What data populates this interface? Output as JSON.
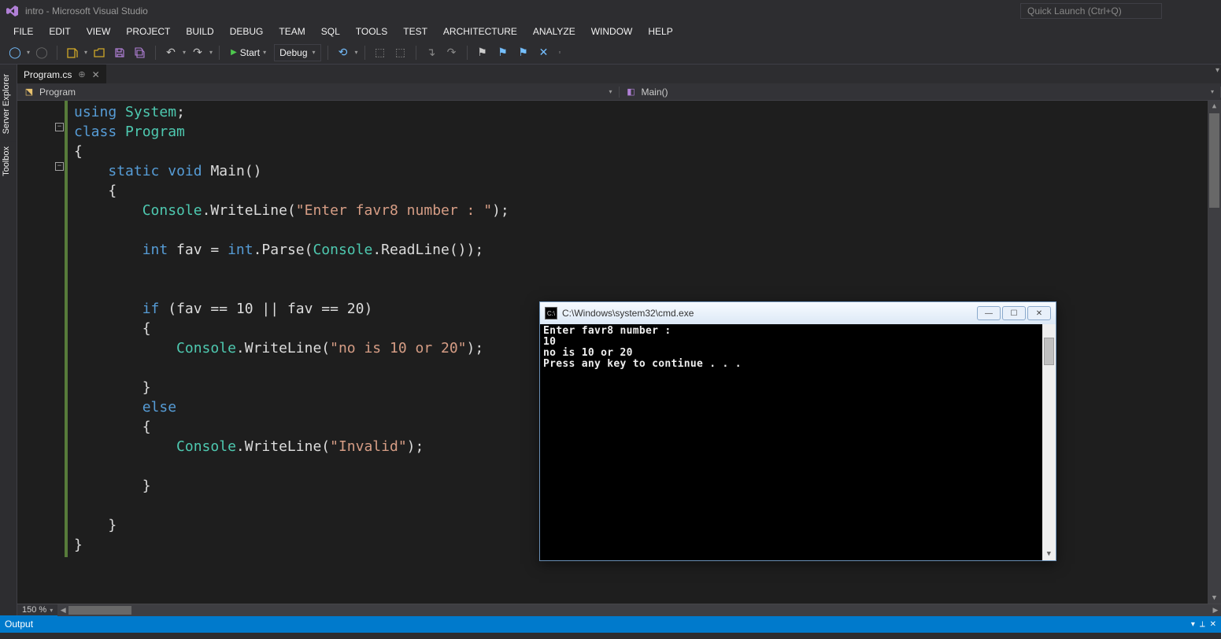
{
  "title_bar": {
    "app_title": "intro - Microsoft Visual Studio",
    "quick_launch_placeholder": "Quick Launch (Ctrl+Q)"
  },
  "menu": [
    "FILE",
    "EDIT",
    "VIEW",
    "PROJECT",
    "BUILD",
    "DEBUG",
    "TEAM",
    "SQL",
    "TOOLS",
    "TEST",
    "ARCHITECTURE",
    "ANALYZE",
    "WINDOW",
    "HELP"
  ],
  "toolbar": {
    "start_label": "Start",
    "config_label": "Debug"
  },
  "side_tabs": [
    "Server Explorer",
    "Toolbox"
  ],
  "editor": {
    "tab_name": "Program.cs",
    "breadcrumb_left": "Program",
    "breadcrumb_right": "Main()",
    "zoom": "150 %"
  },
  "code": {
    "l1_using": "using",
    "l1_system": "System",
    "l1_semi": ";",
    "l2_class": "class",
    "l2_program": "Program",
    "l3_open": "{",
    "l4_static": "static",
    "l4_void": "void",
    "l4_main": "Main",
    "l4_parens": "()",
    "l5_open": "{",
    "l6_console": "Console",
    "l6_dot": ".",
    "l6_writeline": "WriteLine",
    "l6_open_p": "(",
    "l6_str": "\"Enter favr8 number : \"",
    "l6_close": ");",
    "l8_int": "int",
    "l8_fav": " fav = ",
    "l8_int2": "int",
    "l8_parse": ".Parse(",
    "l8_console": "Console",
    "l8_readline": ".ReadLine());",
    "l10_if": "if",
    "l10_cond": " (fav == 10 || fav == 20)",
    "l11_open": "{",
    "l12_console": "Console",
    "l12_write": ".WriteLine(",
    "l12_str": "\"no is 10 or 20\"",
    "l12_close": ");",
    "l14_close": "}",
    "l15_else": "else",
    "l16_open": "{",
    "l17_console": "Console",
    "l17_write": ".WriteLine(",
    "l17_str": "\"Invalid\"",
    "l17_close": ");",
    "l19_close": "}",
    "l21_close": "}",
    "l22_close": "}"
  },
  "output_panel": {
    "title": "Output"
  },
  "cmd": {
    "title": "C:\\Windows\\system32\\cmd.exe",
    "line1": "Enter favr8 number :",
    "line2": "10",
    "line3": "no is 10 or 20",
    "line4": "Press any key to continue . . ."
  }
}
